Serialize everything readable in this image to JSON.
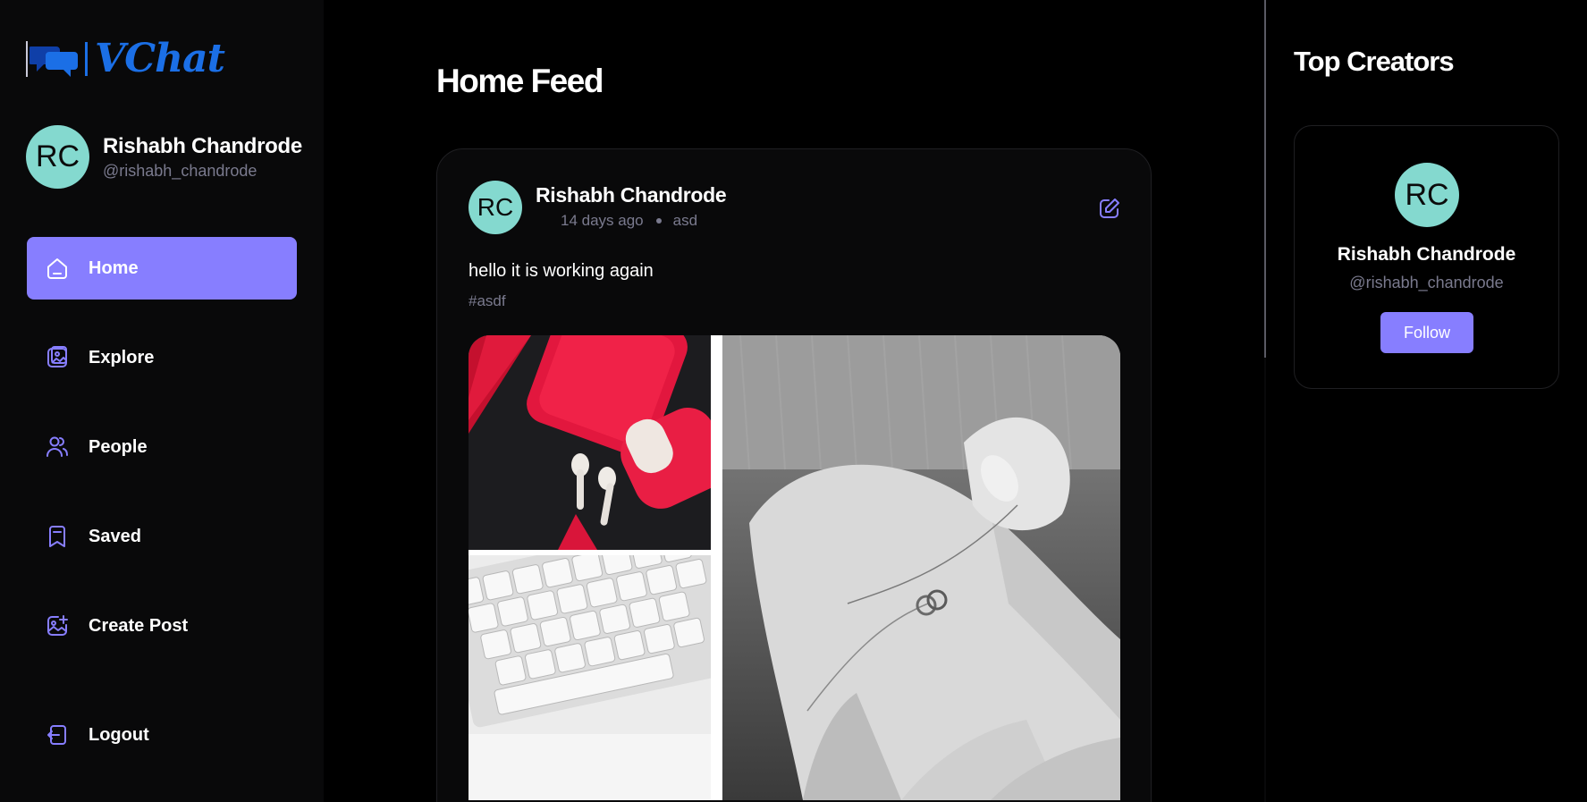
{
  "app": {
    "name": "VChat",
    "accent_color": "#877eff",
    "logo_color": "#1b6fe6"
  },
  "user": {
    "initials": "RC",
    "name": "Rishabh Chandrode",
    "handle": "@rishabh_chandrode"
  },
  "sidebar": {
    "items": [
      {
        "label": "Home",
        "icon": "home-icon",
        "active": true
      },
      {
        "label": "Explore",
        "icon": "gallery-icon",
        "active": false
      },
      {
        "label": "People",
        "icon": "people-icon",
        "active": false
      },
      {
        "label": "Saved",
        "icon": "bookmark-icon",
        "active": false
      },
      {
        "label": "Create Post",
        "icon": "add-image-icon",
        "active": false
      }
    ],
    "logout_label": "Logout"
  },
  "main": {
    "title": "Home Feed",
    "posts": [
      {
        "author_initials": "RC",
        "author": "Rishabh Chandrode",
        "time": "14 days ago",
        "location": "asd",
        "caption": "hello it is working again",
        "tags": "#asdf"
      }
    ]
  },
  "right_panel": {
    "title": "Top Creators",
    "creators": [
      {
        "initials": "RC",
        "name": "Rishabh Chandrode",
        "handle": "@rishabh_chandrode",
        "follow_label": "Follow"
      }
    ]
  }
}
